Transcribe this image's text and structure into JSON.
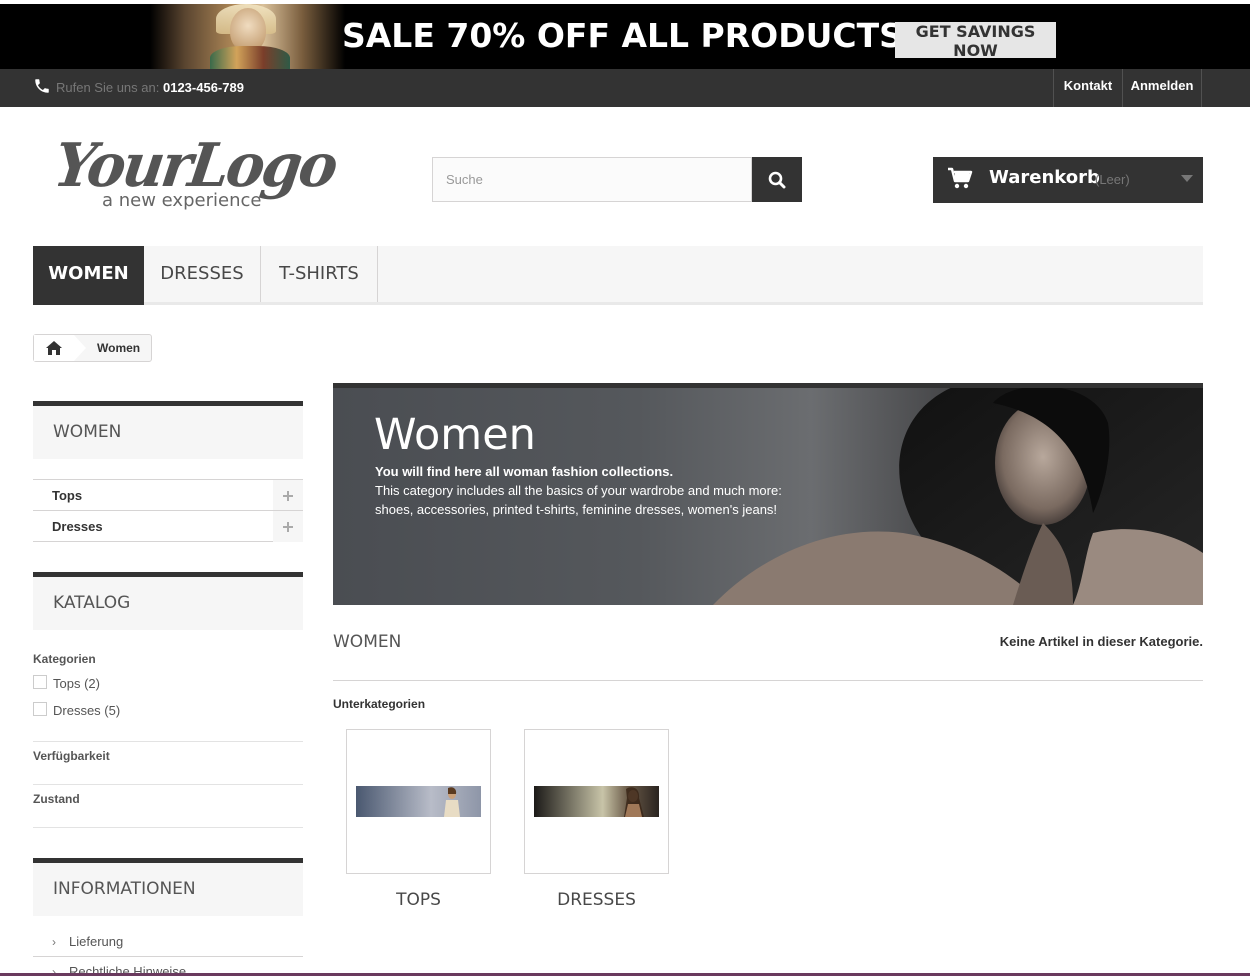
{
  "promo": {
    "title": "SALE 70% OFF ALL PRODUCTS",
    "cta": "GET SAVINGS NOW"
  },
  "topbar": {
    "phone_label": "Rufen Sie uns an:",
    "phone_number": "0123-456-789",
    "contact": "Kontakt",
    "login": "Anmelden"
  },
  "header": {
    "logo_main": "YourLogo",
    "logo_tagline": "a new experience",
    "search_placeholder": "Suche",
    "cart_title": "Warenkorb",
    "cart_status": "(Leer)"
  },
  "menu": {
    "items": [
      "WOMEN",
      "DRESSES",
      "T-SHIRTS"
    ]
  },
  "breadcrumb": {
    "current": "Women"
  },
  "sidebar": {
    "women_title": "WOMEN",
    "categories": [
      "Tops",
      "Dresses"
    ],
    "catalog_title": "KATALOG",
    "filter_categories": "Kategorien",
    "filter_options": [
      "Tops (2)",
      "Dresses (5)"
    ],
    "filter_availability": "Verfügbarkeit",
    "filter_condition": "Zustand",
    "info_title": "INFORMATIONEN",
    "info_links": [
      "Lieferung",
      "Rechtliche Hinweise"
    ]
  },
  "category": {
    "title": "Women",
    "desc_line1": "You will find here all woman fashion collections.",
    "desc_line2": "This category includes all the basics of your wardrobe and much more:",
    "desc_line3": "shoes, accessories, printed t-shirts, feminine dresses, women's jeans!",
    "heading": "WOMEN",
    "no_items": "Keine Artikel in dieser Kategorie.",
    "subcategories_heading": "Unterkategorien",
    "subcategories": [
      "TOPS",
      "DRESSES"
    ]
  },
  "colors": {
    "dark": "#333333",
    "light_bg": "#f6f6f6",
    "border": "#d6d4d4"
  }
}
